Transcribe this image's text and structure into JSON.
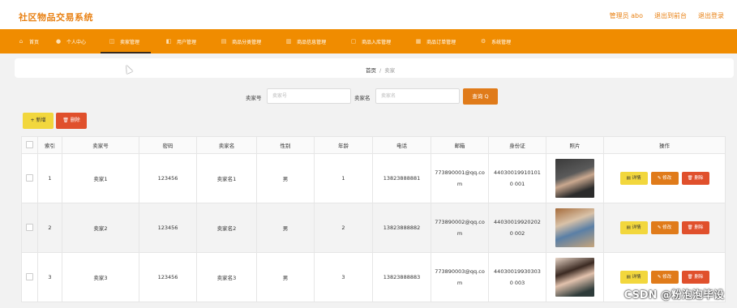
{
  "app": {
    "title": "社区物品交易系统"
  },
  "topbar": {
    "user": "管理员 abo",
    "back_link": "退出到前台",
    "logout_link": "退出登录"
  },
  "nav": [
    {
      "label": "首页",
      "icon": "home-icon"
    },
    {
      "label": "个人中心",
      "icon": "user-icon"
    },
    {
      "label": "卖家管理",
      "icon": "seller-icon",
      "active": true
    },
    {
      "label": "用户管理",
      "icon": "users-icon"
    },
    {
      "label": "商品分类管理",
      "icon": "category-icon"
    },
    {
      "label": "商品信息管理",
      "icon": "goods-icon"
    },
    {
      "label": "商品入库管理",
      "icon": "storage-icon"
    },
    {
      "label": "商品订单管理",
      "icon": "order-icon"
    },
    {
      "label": "系统管理",
      "icon": "settings-icon"
    }
  ],
  "breadcrumb": {
    "home": "首页",
    "separator": "/",
    "current": "卖家"
  },
  "search": {
    "seller_no_label": "卖家号",
    "seller_no_placeholder": "卖家号",
    "seller_name_label": "卖家名",
    "seller_name_placeholder": "卖家名",
    "query_button": "查询 Q"
  },
  "actions": {
    "add": "+ 新增",
    "delete": "删除"
  },
  "table": {
    "headers": [
      "",
      "索引",
      "卖家号",
      "密码",
      "卖家名",
      "性别",
      "年龄",
      "电话",
      "邮箱",
      "身份证",
      "照片",
      "操作"
    ],
    "rows": [
      {
        "index": "1",
        "seller_no": "卖家1",
        "password": "123456",
        "seller_name": "卖家名1",
        "gender": "男",
        "age": "1",
        "phone": "13823888881",
        "email": "773890001@qq.co m",
        "id_card": "440300199101010 001"
      },
      {
        "index": "2",
        "seller_no": "卖家2",
        "password": "123456",
        "seller_name": "卖家名2",
        "gender": "男",
        "age": "2",
        "phone": "13823888882",
        "email": "773890002@qq.co m",
        "id_card": "440300199202020 002"
      },
      {
        "index": "3",
        "seller_no": "卖家3",
        "password": "123456",
        "seller_name": "卖家名3",
        "gender": "男",
        "age": "3",
        "phone": "13823888883",
        "email": "773890003@qq.co m",
        "id_card": "440300199303030 003"
      }
    ],
    "row_actions": {
      "detail": "详情",
      "edit": "修改",
      "delete": "删除"
    }
  },
  "watermark": "CSDN @粉泡泡毕设",
  "colors": {
    "accent": "#f08c00",
    "brand": "#e88114",
    "yellow": "#f2d73d",
    "red": "#e0502c"
  }
}
